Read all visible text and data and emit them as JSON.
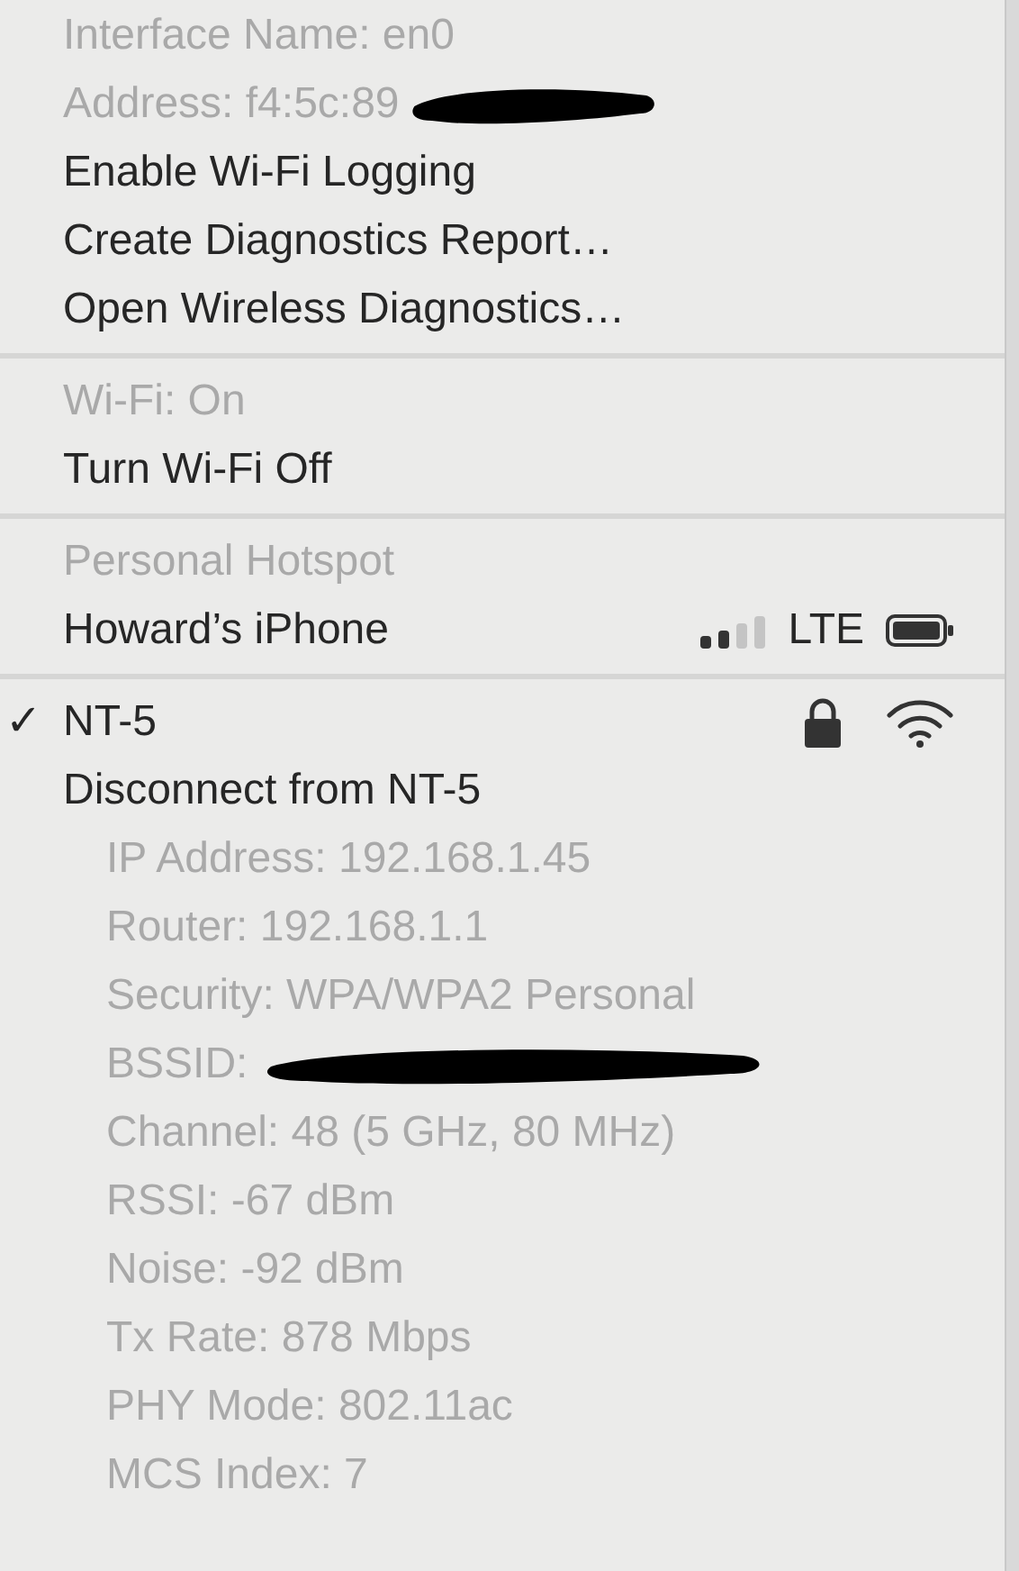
{
  "sections": [
    {
      "items": [
        {
          "kind": "info",
          "text": "Interface Name: en0"
        },
        {
          "kind": "info",
          "text": "Address: f4:5c:89",
          "redacted": true
        },
        {
          "kind": "action",
          "text": "Enable Wi-Fi Logging"
        },
        {
          "kind": "action",
          "text": "Create Diagnostics Report…"
        },
        {
          "kind": "action",
          "text": "Open Wireless Diagnostics…"
        }
      ]
    },
    {
      "items": [
        {
          "kind": "info",
          "text": "Wi-Fi: On"
        },
        {
          "kind": "action",
          "text": "Turn Wi-Fi Off"
        }
      ]
    },
    {
      "items": [
        {
          "kind": "info",
          "text": "Personal Hotspot"
        },
        {
          "kind": "hotspot",
          "text": "Howard’s iPhone",
          "network_type": "LTE"
        }
      ]
    },
    {
      "items": [
        {
          "kind": "network",
          "text": "NT-5",
          "checked": true,
          "check": "✓",
          "locked": true
        },
        {
          "kind": "action",
          "text": "Disconnect from NT-5"
        },
        {
          "kind": "detail",
          "text": "IP Address: 192.168.1.45"
        },
        {
          "kind": "detail",
          "text": "Router: 192.168.1.1"
        },
        {
          "kind": "detail",
          "text": "Security: WPA/WPA2 Personal"
        },
        {
          "kind": "detail",
          "text": "BSSID:",
          "redacted": true
        },
        {
          "kind": "detail",
          "text": "Channel: 48 (5 GHz, 80 MHz)"
        },
        {
          "kind": "detail",
          "text": "RSSI: -67 dBm"
        },
        {
          "kind": "detail",
          "text": "Noise: -92 dBm"
        },
        {
          "kind": "detail",
          "text": "Tx Rate: 878 Mbps"
        },
        {
          "kind": "detail",
          "text": "PHY Mode: 802.11ac"
        },
        {
          "kind": "detail",
          "text": "MCS Index: 7"
        }
      ]
    }
  ]
}
